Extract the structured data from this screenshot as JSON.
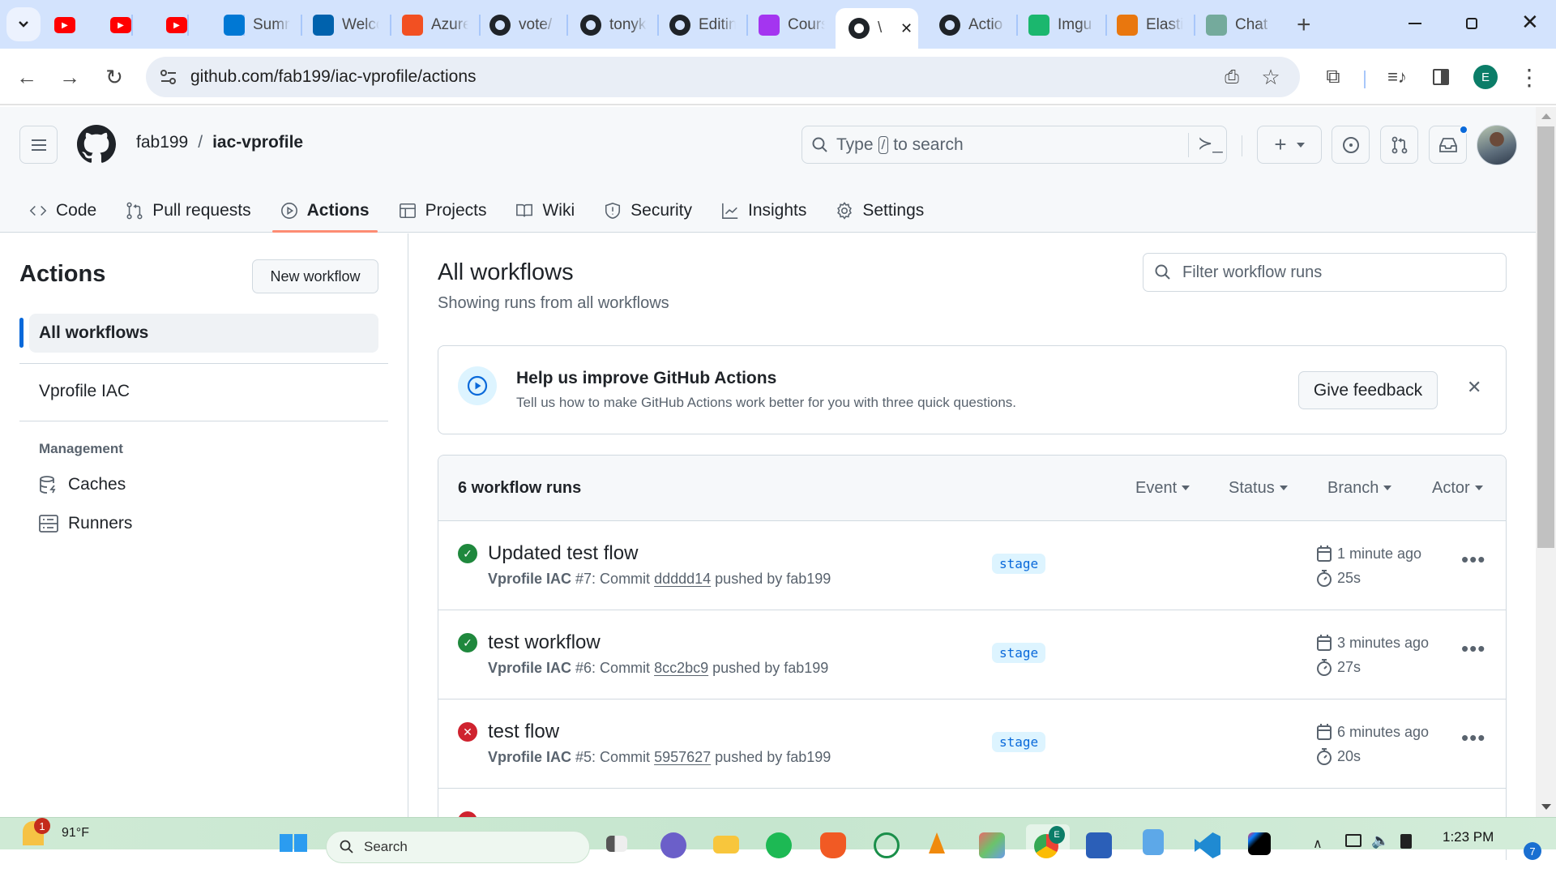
{
  "browser": {
    "tabs": [
      {
        "title": "",
        "icon": "youtube-icon",
        "color": "#ff0000"
      },
      {
        "title": "",
        "icon": "youtube-icon",
        "color": "#ff0000"
      },
      {
        "title": "",
        "icon": "youtube-icon",
        "color": "#ff0000"
      },
      {
        "title": "Summ",
        "icon": "azure-devops-icon",
        "color": "#0078d4"
      },
      {
        "title": "Welco",
        "icon": "azure-icon",
        "color": "#0062ad"
      },
      {
        "title": "Azure",
        "icon": "microsoft-icon",
        "color": "#f25022"
      },
      {
        "title": "vote/",
        "icon": "github-icon",
        "color": "#1f2328"
      },
      {
        "title": "tonyk",
        "icon": "github-icon",
        "color": "#1f2328"
      },
      {
        "title": "Editin",
        "icon": "github-icon",
        "color": "#1f2328"
      },
      {
        "title": "Cours",
        "icon": "udemy-icon",
        "color": "#a435f0"
      },
      {
        "title": "\\",
        "icon": "github-icon",
        "color": "#1f2328",
        "active": true
      },
      {
        "title": "Actio",
        "icon": "github-icon",
        "color": "#1f2328"
      },
      {
        "title": "Imgu",
        "icon": "imgur-icon",
        "color": "#1bb76e"
      },
      {
        "title": "Elasti",
        "icon": "elastic-icon",
        "color": "#e9770e"
      },
      {
        "title": "Chat",
        "icon": "chatgpt-icon",
        "color": "#74aa9c"
      }
    ],
    "url": "github.com/fab199/iac-vprofile/actions",
    "profile_initial": "E"
  },
  "github": {
    "owner": "fab199",
    "separator": "/",
    "repo": "iac-vprofile",
    "search_placeholder_prefix": "Type",
    "search_key": "/",
    "search_placeholder_suffix": "to search",
    "nav": [
      {
        "label": "Code",
        "icon": "code-icon"
      },
      {
        "label": "Pull requests",
        "icon": "pull-request-icon"
      },
      {
        "label": "Actions",
        "icon": "play-icon",
        "active": true
      },
      {
        "label": "Projects",
        "icon": "table-icon"
      },
      {
        "label": "Wiki",
        "icon": "book-icon"
      },
      {
        "label": "Security",
        "icon": "shield-icon"
      },
      {
        "label": "Insights",
        "icon": "graph-icon"
      },
      {
        "label": "Settings",
        "icon": "gear-icon"
      }
    ]
  },
  "sidebar": {
    "title": "Actions",
    "new_workflow": "New workflow",
    "workflows": [
      {
        "label": "All workflows",
        "active": true
      },
      {
        "label": "Vprofile IAC"
      }
    ],
    "management_heading": "Management",
    "management": [
      {
        "label": "Caches",
        "icon": "database-icon"
      },
      {
        "label": "Runners",
        "icon": "server-icon"
      }
    ]
  },
  "main": {
    "title": "All workflows",
    "subtitle": "Showing runs from all workflows",
    "filter_placeholder": "Filter workflow runs",
    "banner": {
      "title": "Help us improve GitHub Actions",
      "text": "Tell us how to make GitHub Actions work better for you with three quick questions.",
      "button": "Give feedback"
    },
    "runs_count": "6 workflow runs",
    "filters": [
      "Event",
      "Status",
      "Branch",
      "Actor"
    ],
    "runs": [
      {
        "title": "Updated test flow",
        "status": "success",
        "workflow": "Vprofile IAC",
        "run": "#7: Commit",
        "commit": "ddddd14",
        "pushed": "pushed by fab199",
        "branch": "stage",
        "when": "1 minute ago",
        "duration": "25s"
      },
      {
        "title": "test workflow",
        "status": "success",
        "workflow": "Vprofile IAC",
        "run": "#6: Commit",
        "commit": "8cc2bc9",
        "pushed": "pushed by fab199",
        "branch": "stage",
        "when": "3 minutes ago",
        "duration": "27s"
      },
      {
        "title": "test flow",
        "status": "failure",
        "workflow": "Vprofile IAC",
        "run": "#5: Commit",
        "commit": "5957627",
        "pushed": "pushed by fab199",
        "branch": "stage",
        "when": "6 minutes ago",
        "duration": "20s"
      },
      {
        "title": "",
        "status": "failure"
      }
    ]
  },
  "taskbar": {
    "weather": "91°F",
    "weather_badge": "1",
    "search": "Search",
    "time": "1:23 PM",
    "notif_count": "7"
  },
  "colors": {
    "success": "#1f883d",
    "failure": "#cf222e",
    "accent": "#0969da",
    "nav_underline": "#fd8c73"
  }
}
